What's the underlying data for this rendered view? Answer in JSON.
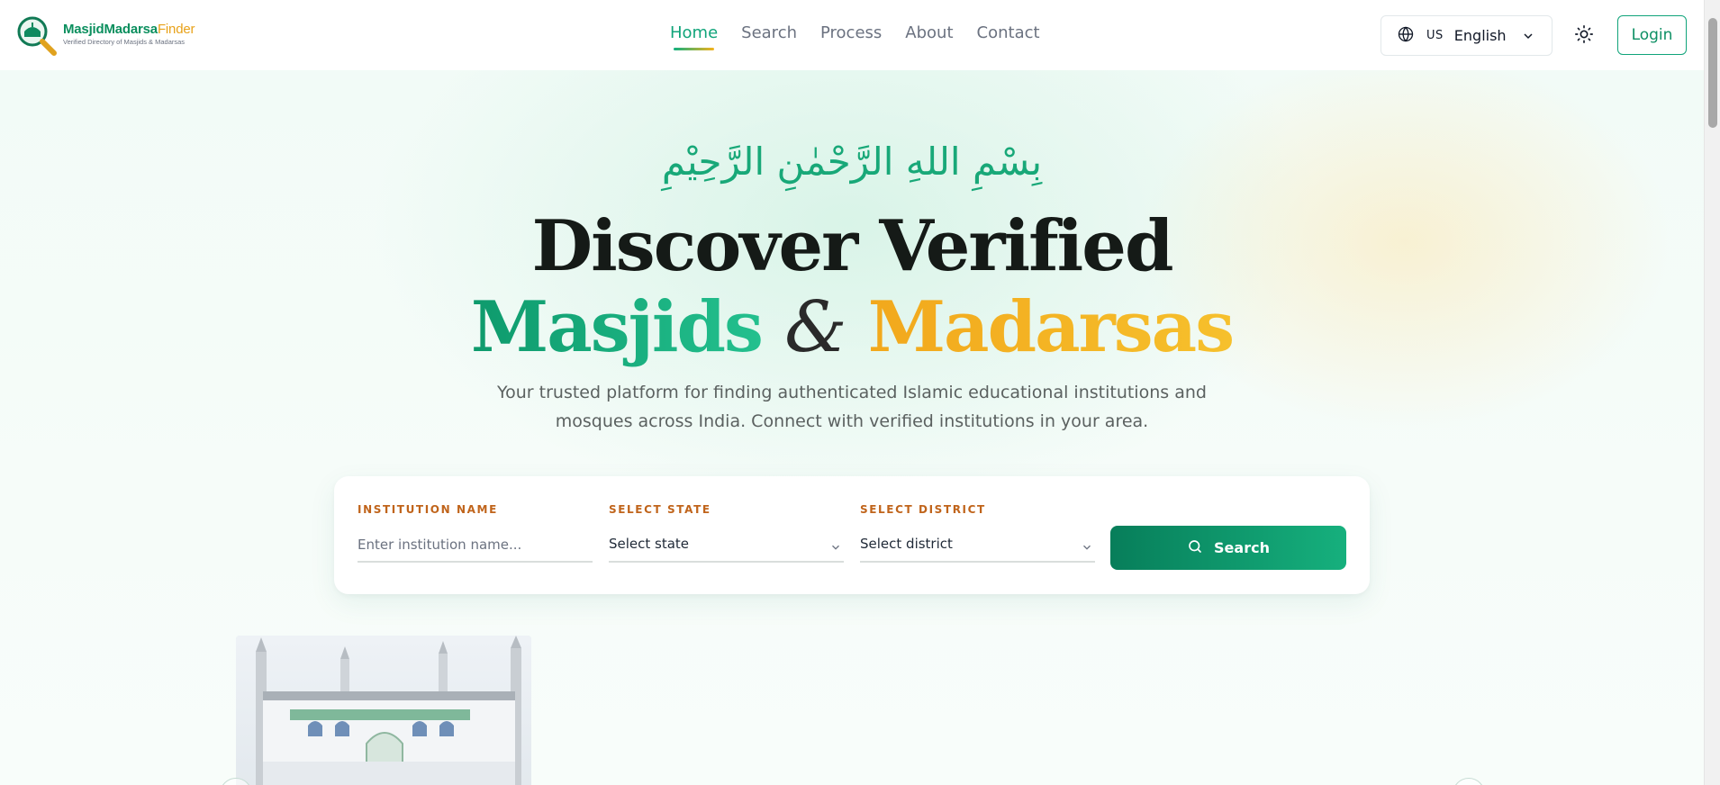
{
  "header": {
    "logo": {
      "title_part1": "MasjidMadarsa",
      "title_part2": "Finder",
      "subtitle": "Verified Directory of Masjids & Madarsas"
    },
    "nav": [
      {
        "label": "Home",
        "active": true
      },
      {
        "label": "Search",
        "active": false
      },
      {
        "label": "Process",
        "active": false
      },
      {
        "label": "About",
        "active": false
      },
      {
        "label": "Contact",
        "active": false
      }
    ],
    "language": {
      "code": "US",
      "label": "English"
    },
    "login_label": "Login"
  },
  "hero": {
    "bismillah": "بِسْمِ اللهِ الرَّحْمٰنِ الرَّحِيْمِ",
    "headline_line1": "Discover Verified",
    "headline_word_green": "Masjids",
    "headline_amp": "&",
    "headline_word_gold": "Madarsas",
    "subtitle": "Your trusted platform for finding authenticated Islamic educational institutions and mosques across India. Connect with verified institutions in your area."
  },
  "search": {
    "institution": {
      "label": "INSTITUTION NAME",
      "placeholder": "Enter institution name..."
    },
    "state": {
      "label": "SELECT STATE",
      "value": "Select state"
    },
    "district": {
      "label": "SELECT DISTRICT",
      "value": "Select district"
    },
    "button_label": "Search"
  },
  "colors": {
    "brand_green": "#10a47a",
    "brand_gold": "#f2a81c",
    "label_orange": "#c0641b"
  },
  "icons": {
    "globe": "globe-icon",
    "chevron": "chevron-down-icon",
    "theme": "sun-icon",
    "search": "search-icon"
  }
}
